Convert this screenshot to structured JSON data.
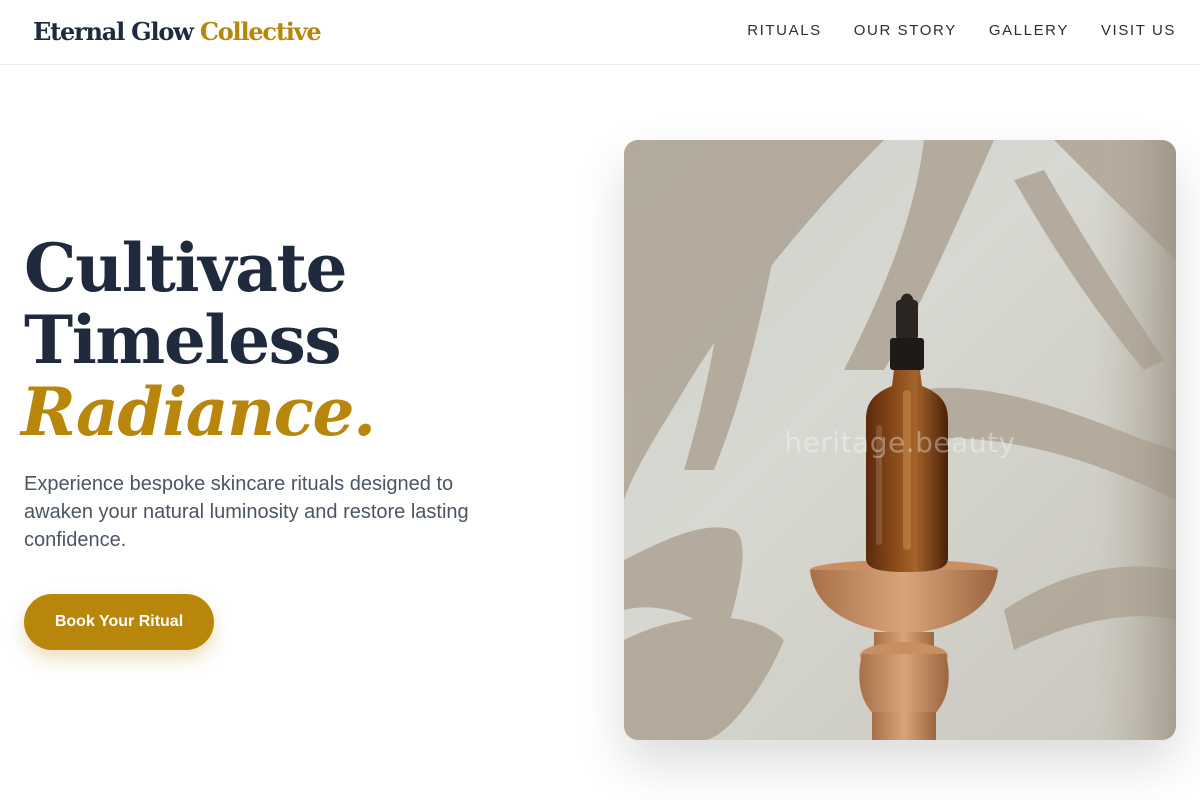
{
  "header": {
    "brand_main": "Eternal Glow",
    "brand_accent": "Collective",
    "nav": [
      {
        "label": "RITUALS"
      },
      {
        "label": "OUR STORY"
      },
      {
        "label": "GALLERY"
      },
      {
        "label": "VISIT US"
      }
    ]
  },
  "hero": {
    "title_line1": "Cultivate",
    "title_line2": "Timeless",
    "title_accent": "Radiance.",
    "subtitle": "Experience bespoke skincare rituals designed to awaken your natural luminosity and restore lasting confidence.",
    "cta_label": "Book Your Ritual",
    "image_watermark": "heritage.beauty"
  },
  "colors": {
    "navy": "#1f2a3d",
    "gold": "#b8860b",
    "body_text": "#4b5563"
  },
  "icons": {
    "product": "serum-dropper-bottle"
  }
}
